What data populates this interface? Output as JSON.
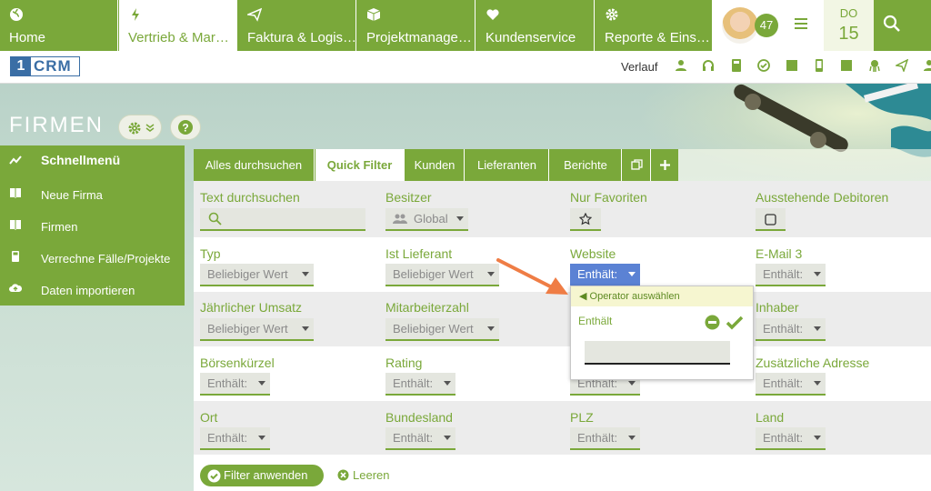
{
  "nav": {
    "tabs": [
      {
        "label": "Home",
        "icon": "globe-icon"
      },
      {
        "label": "Vertrieb & Mar…",
        "icon": "bolt-icon"
      },
      {
        "label": "Faktura & Logis…",
        "icon": "paper-plane-icon"
      },
      {
        "label": "Projektmanage…",
        "icon": "cube-icon"
      },
      {
        "label": "Kundenservice",
        "icon": "heart-icon"
      },
      {
        "label": "Reporte & Eins…",
        "icon": "gear-icon"
      }
    ],
    "notifications": "47",
    "day_of_week": "DO",
    "day": "15"
  },
  "subbar": {
    "logo_num": "1",
    "logo_text": "CRM",
    "history_label": "Verlauf"
  },
  "page": {
    "title": "FIRMEN"
  },
  "sidemenu": {
    "items": [
      {
        "label": "Schnellmenü",
        "icon": "trend-icon"
      },
      {
        "label": "Neue Firma",
        "icon": "book-icon"
      },
      {
        "label": "Firmen",
        "icon": "book-icon"
      },
      {
        "label": "Verrechne Fälle/Projekte",
        "icon": "calculator-icon"
      },
      {
        "label": "Daten importieren",
        "icon": "cloud-upload-icon"
      }
    ]
  },
  "filter_tabs": [
    "Alles durchsuchen",
    "Quick Filter",
    "Kunden",
    "Lieferanten",
    "Berichte"
  ],
  "filters": {
    "text_search": {
      "label": "Text durchsuchen"
    },
    "owner": {
      "label": "Besitzer",
      "value": "Global"
    },
    "favorites": {
      "label": "Nur Favoriten"
    },
    "outstanding": {
      "label": "Ausstehende Debitoren"
    },
    "type": {
      "label": "Typ",
      "value": "Beliebiger Wert"
    },
    "supplier": {
      "label": "Ist Lieferant",
      "value": "Beliebiger Wert"
    },
    "website": {
      "label": "Website",
      "value": "Enthält:"
    },
    "email3": {
      "label": "E-Mail 3",
      "value": "Enthält:"
    },
    "revenue": {
      "label": "Jährlicher Umsatz",
      "value": "Beliebiger Wert"
    },
    "employees": {
      "label": "Mitarbeiterzahl",
      "value": "Beliebiger Wert"
    },
    "owner_name": {
      "label": "Inhaber",
      "value": "Enthält:"
    },
    "ticker": {
      "label": "Börsenkürzel",
      "value": "Enthält:"
    },
    "rating": {
      "label": "Rating",
      "value": "Enthält:"
    },
    "hidden3": {
      "value": "Enthält:"
    },
    "address": {
      "label": "Zusätzliche Adresse",
      "value": "Enthält:"
    },
    "city": {
      "label": "Ort",
      "value": "Enthält:"
    },
    "state": {
      "label": "Bundesland",
      "value": "Enthält:"
    },
    "zip": {
      "label": "PLZ",
      "value": "Enthält:"
    },
    "country": {
      "label": "Land",
      "value": "Enthält:"
    }
  },
  "popup": {
    "header": "Operator auswählen",
    "operator": "Enthält"
  },
  "actions": {
    "apply": "Filter anwenden",
    "reset": "Leeren"
  },
  "colors": {
    "brand_green": "#7aa83a",
    "select_blue": "#5b82d4",
    "arrow_orange": "#ef7d45"
  }
}
